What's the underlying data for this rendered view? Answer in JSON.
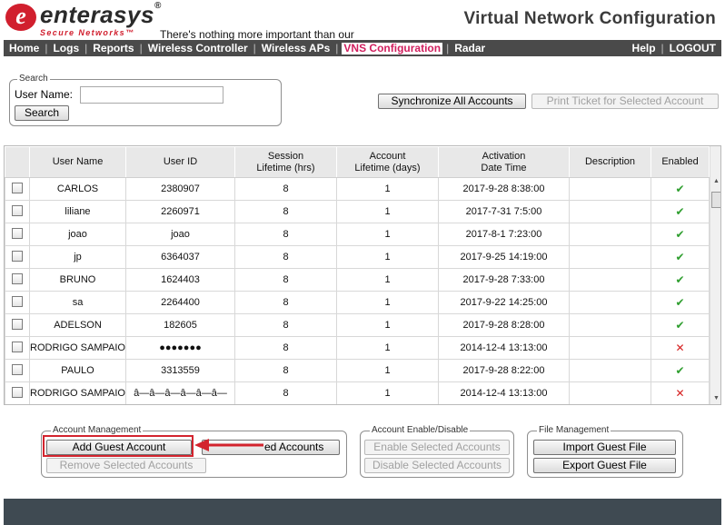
{
  "header": {
    "brand": "enterasys",
    "brand_mark": "®",
    "subbrand": "Secure Networks™",
    "tagline": "There's nothing more important than our customers.",
    "page_title": "Virtual Network Configuration"
  },
  "nav": {
    "items": [
      "Home",
      "Logs",
      "Reports",
      "Wireless Controller",
      "Wireless APs",
      "VNS Configuration",
      "Radar"
    ],
    "active": "VNS Configuration",
    "right_items": [
      "Help",
      "LOGOUT"
    ],
    "separator": "|"
  },
  "search": {
    "legend": "Search",
    "user_name_label": "User Name:",
    "user_name_value": "",
    "search_button": "Search"
  },
  "toolbar": {
    "sync_button": "Synchronize All Accounts",
    "print_button": "Print Ticket for Selected Account"
  },
  "table": {
    "columns": [
      "",
      "User Name",
      "User ID",
      "Session\nLifetime (hrs)",
      "Account\nLifetime (days)",
      "Activation\nDate Time",
      "Description",
      "Enabled"
    ],
    "rows": [
      {
        "user_name": "CARLOS",
        "user_id": "2380907",
        "session": "8",
        "account": "1",
        "activation": "2017-9-28 8:38:00",
        "description": "",
        "enabled": true
      },
      {
        "user_name": "liliane",
        "user_id": "2260971",
        "session": "8",
        "account": "1",
        "activation": "2017-7-31 7:5:00",
        "description": "",
        "enabled": true
      },
      {
        "user_name": "joao",
        "user_id": "joao",
        "session": "8",
        "account": "1",
        "activation": "2017-8-1 7:23:00",
        "description": "",
        "enabled": true
      },
      {
        "user_name": "jp",
        "user_id": "6364037",
        "session": "8",
        "account": "1",
        "activation": "2017-9-25 14:19:00",
        "description": "",
        "enabled": true
      },
      {
        "user_name": "BRUNO",
        "user_id": "1624403",
        "session": "8",
        "account": "1",
        "activation": "2017-9-28 7:33:00",
        "description": "",
        "enabled": true
      },
      {
        "user_name": "sa",
        "user_id": "2264400",
        "session": "8",
        "account": "1",
        "activation": "2017-9-22 14:25:00",
        "description": "",
        "enabled": true
      },
      {
        "user_name": "ADELSON",
        "user_id": "182605",
        "session": "8",
        "account": "1",
        "activation": "2017-9-28 8:28:00",
        "description": "",
        "enabled": true
      },
      {
        "user_name": "RODRIGO SAMPAIO",
        "user_id": "●●●●●●●",
        "session": "8",
        "account": "1",
        "activation": "2014-12-4 13:13:00",
        "description": "",
        "enabled": false
      },
      {
        "user_name": "PAULO",
        "user_id": "3313559",
        "session": "8",
        "account": "1",
        "activation": "2017-9-28 8:22:00",
        "description": "",
        "enabled": true
      },
      {
        "user_name": "RODRIGO SAMPAIO",
        "user_id": "â—â—â—â—â—â—",
        "session": "8",
        "account": "1",
        "activation": "2014-12-4 13:13:00",
        "description": "",
        "enabled": false
      }
    ],
    "enabled_glyph": "✔",
    "disabled_glyph": "✕"
  },
  "account_management": {
    "legend": "Account Management",
    "add_button": "Add Guest Account",
    "hidden_button_fragment": "ed Accounts",
    "remove_button": "Remove Selected Accounts"
  },
  "account_enable": {
    "legend": "Account Enable/Disable",
    "enable_button": "Enable Selected Accounts",
    "disable_button": "Disable Selected Accounts"
  },
  "file_management": {
    "legend": "File Management",
    "import_button": "Import Guest File",
    "export_button": "Export Guest File"
  },
  "colors": {
    "brand_red": "#d11f2e",
    "nav_bg": "#4a4a4a",
    "nav_active_text": "#d11f5e",
    "highlight": "#d3242e",
    "enabled": "#2e9e2e",
    "disabled": "#d62020"
  }
}
